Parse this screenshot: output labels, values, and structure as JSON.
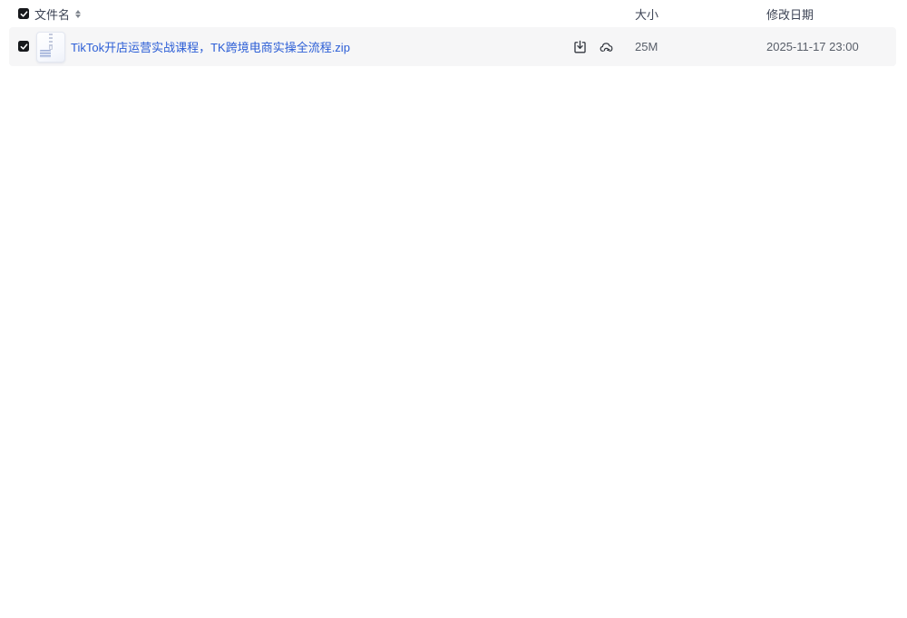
{
  "header": {
    "columns": {
      "name": "文件名",
      "size": "大小",
      "modified": "修改日期"
    },
    "select_all_checked": true,
    "sorter_icon": "caret-up-down"
  },
  "rows": [
    {
      "selected": true,
      "file_type": "zip",
      "file_icon": "zip-file-icon",
      "name": "TikTok开店运营实战课程，TK跨境电商实操全流程.zip",
      "size": "25M",
      "modified": "2025-11-17 23:00",
      "actions": [
        "download-icon",
        "save-to-cloud-icon"
      ]
    }
  ],
  "colors": {
    "link_blue": "#2c5ed6",
    "checkbox_black": "#17191c",
    "row_background": "#f6f6f7",
    "header_text": "#3c4354",
    "secondary_text": "#585e69",
    "icon_stroke": "#33373f"
  }
}
